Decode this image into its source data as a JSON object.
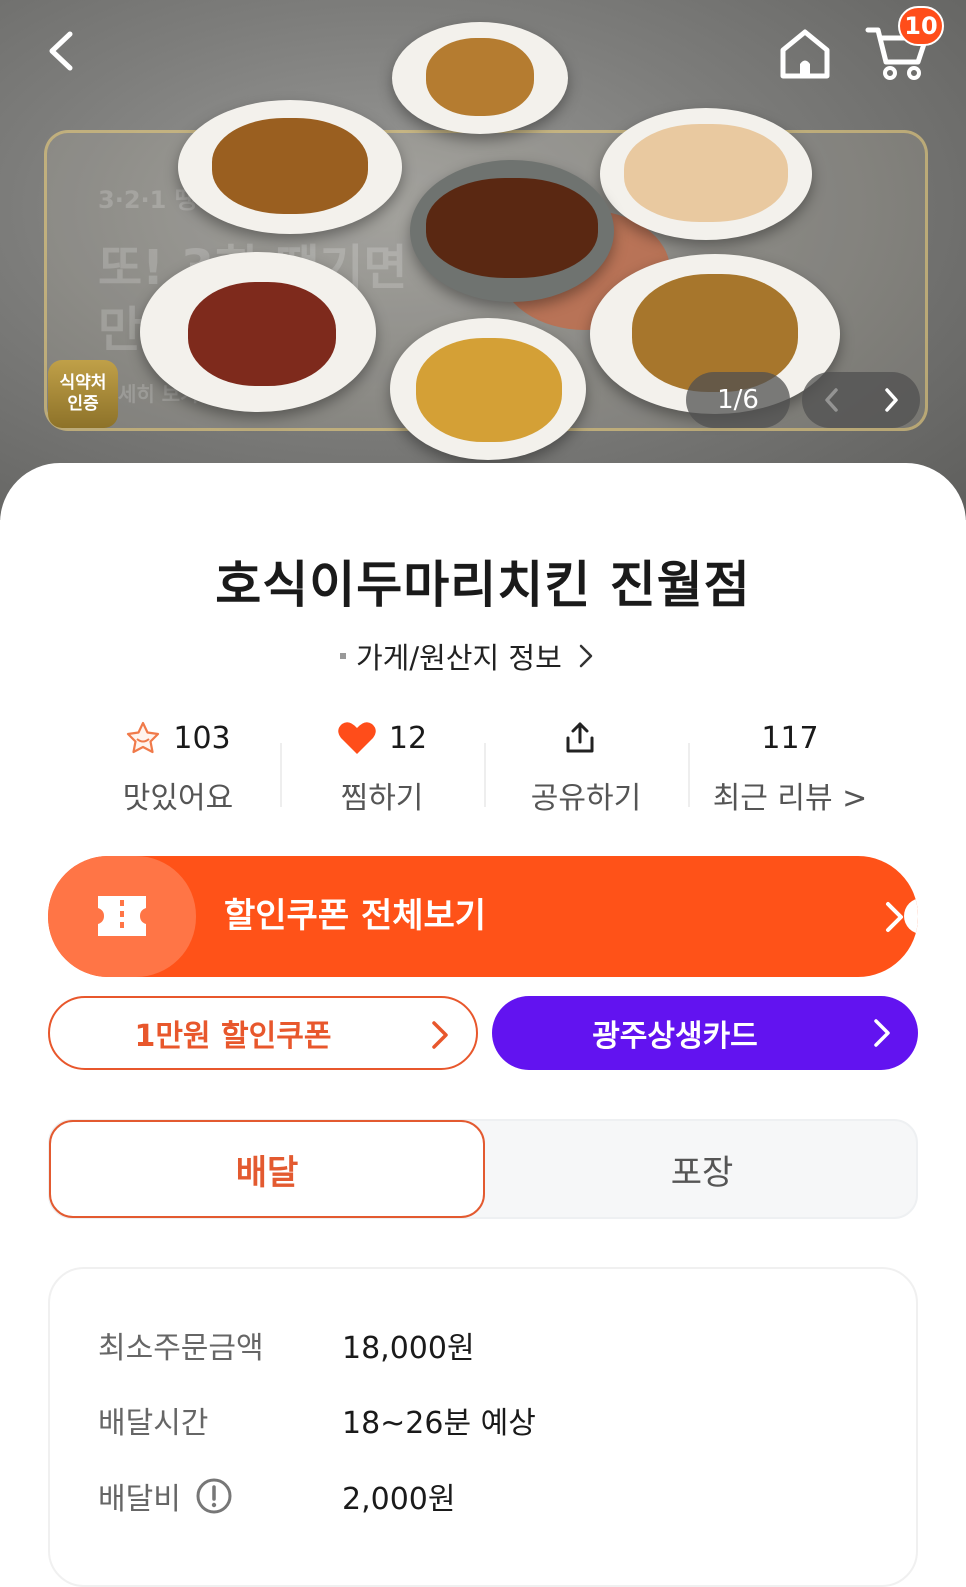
{
  "header": {
    "cart_count": "10",
    "icons": {
      "back": "chevron-left-icon",
      "home": "home-icon",
      "cart": "cart-icon"
    }
  },
  "hero": {
    "cert_badge": [
      "식약처",
      "인증"
    ],
    "slide_counter": "1/6",
    "banner_text": {
      "line1": "3·2·1 땡!",
      "line2": "또! 3회 땡기면",
      "line3": "만원",
      "line4": "세히 보기"
    }
  },
  "store": {
    "name": "호식이두마리치킨 진월점",
    "info_link": "가게/원산지 정보",
    "stats": [
      {
        "value": "103",
        "label": "맛있어요",
        "icon": "star-badge-icon"
      },
      {
        "value": "12",
        "label": "찜하기",
        "icon": "heart-icon"
      },
      {
        "value": "",
        "label": "공유하기",
        "icon": "share-icon"
      },
      {
        "value": "117",
        "label": "최근 리뷰 >",
        "icon": ""
      }
    ]
  },
  "coupons": {
    "all_label": "할인쿠폰 전체보기",
    "coupon_10k": "1만원 할인쿠폰",
    "local_card": "광주상생카드"
  },
  "mode": {
    "delivery": "배달",
    "pickup": "포장",
    "selected": "배달"
  },
  "delivery_info": {
    "min_order_label": "최소주문금액",
    "min_order_value": "18,000원",
    "time_label": "배달시간",
    "time_value": "18~26분 예상",
    "fee_label": "배달비",
    "fee_value": "2,000원"
  },
  "colors": {
    "accent_orange": "#ff5218",
    "coupon_outline": "#e8572c",
    "local_card_purple": "#6213f0",
    "heart_red": "#ff4d1a",
    "cert_gold": "#b09640"
  }
}
